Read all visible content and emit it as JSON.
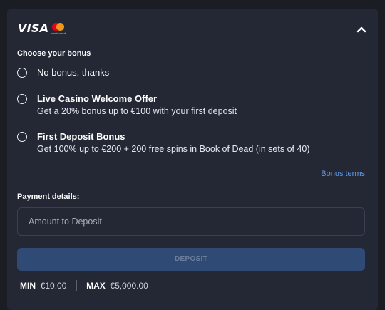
{
  "header": {
    "visa_text": "VISA",
    "mastercard_text": "mastercard",
    "collapse_icon": "chevron-up-icon"
  },
  "bonus": {
    "label": "Choose your bonus",
    "options": [
      {
        "title": "No bonus, thanks",
        "subtitle": ""
      },
      {
        "title": "Live Casino Welcome Offer",
        "subtitle": "Get a 20% bonus up to €100 with your first deposit"
      },
      {
        "title": "First Deposit Bonus",
        "subtitle": "Get 100% up to €200 + 200 free spins in Book of Dead (in sets of 40)"
      }
    ],
    "terms_link": "Bonus terms"
  },
  "payment": {
    "label": "Payment details:",
    "amount_placeholder": "Amount to Deposit",
    "amount_value": "",
    "deposit_label": "DEPOSIT",
    "min_label": "MIN",
    "min_value": "€10.00",
    "max_label": "MAX",
    "max_value": "€5,000.00"
  },
  "colors": {
    "background": "#1b1d25",
    "card": "#242835",
    "button_disabled": "#2f4a74",
    "link": "#5d9cec"
  }
}
